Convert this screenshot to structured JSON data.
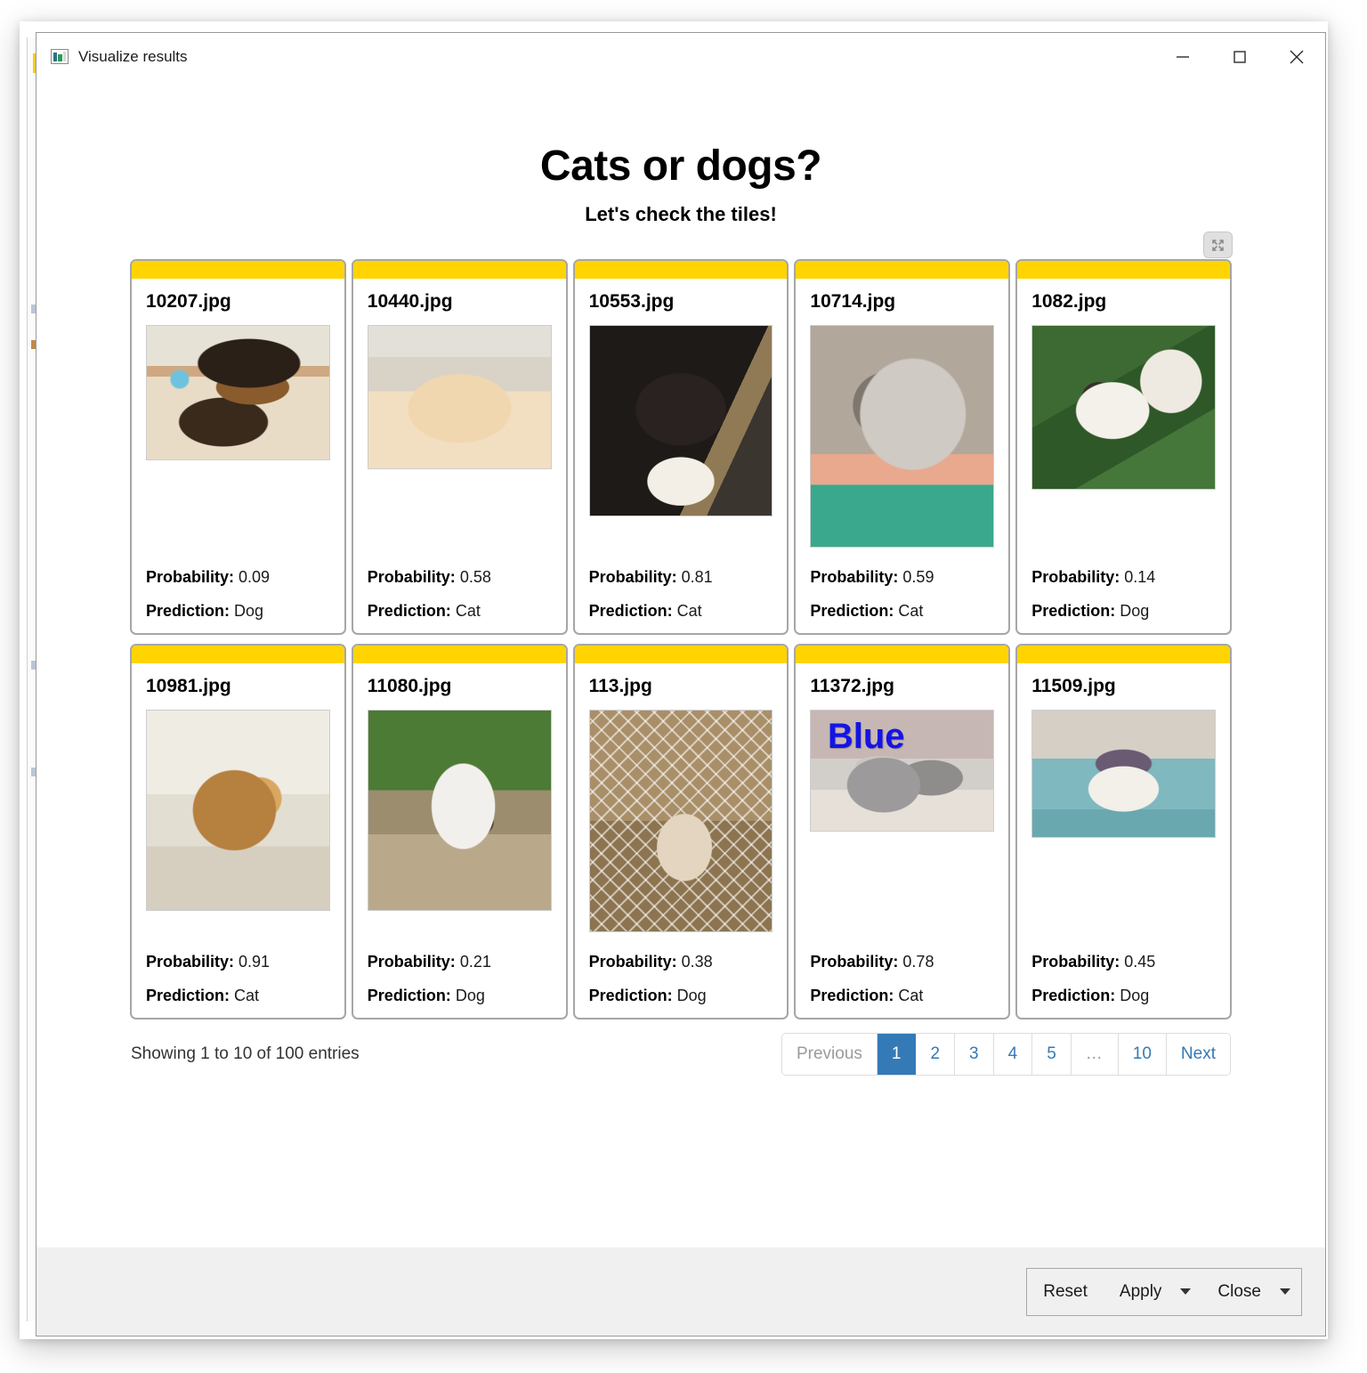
{
  "window": {
    "title": "Visualize results",
    "icon": "app-window-icon",
    "controls": {
      "minimize": "minimize-icon",
      "maximize": "maximize-icon",
      "close": "close-icon"
    }
  },
  "page": {
    "title": "Cats or dogs?",
    "subtitle": "Let's check the tiles!"
  },
  "widget": {
    "expand_button_icon": "expand-icon",
    "labels": {
      "probability": "Probability:",
      "prediction": "Prediction:"
    },
    "accent_color": "#ffd400",
    "active_page_color": "#337ab7",
    "cards": [
      {
        "filename": "10207.jpg",
        "probability": "0.09",
        "prediction": "Dog",
        "art": "ph-dog1",
        "overlay": "",
        "aspect": "0.78"
      },
      {
        "filename": "10440.jpg",
        "probability": "0.58",
        "prediction": "Cat",
        "art": "ph-cat1",
        "overlay": "",
        "aspect": "0.83"
      },
      {
        "filename": "10553.jpg",
        "probability": "0.81",
        "prediction": "Cat",
        "art": "ph-cat2",
        "overlay": "",
        "aspect": "1.10"
      },
      {
        "filename": "10714.jpg",
        "probability": "0.59",
        "prediction": "Cat",
        "art": "ph-dog2",
        "overlay": "",
        "aspect": "1.28"
      },
      {
        "filename": "1082.jpg",
        "probability": "0.14",
        "prediction": "Dog",
        "art": "ph-dog3",
        "overlay": "",
        "aspect": "0.95"
      },
      {
        "filename": "10981.jpg",
        "probability": "0.91",
        "prediction": "Cat",
        "art": "ph-dog4",
        "overlay": "",
        "aspect": "1.16"
      },
      {
        "filename": "11080.jpg",
        "probability": "0.21",
        "prediction": "Dog",
        "art": "ph-dog5",
        "overlay": "",
        "aspect": "1.16"
      },
      {
        "filename": "113.jpg",
        "probability": "0.38",
        "prediction": "Dog",
        "art": "ph-dog6",
        "overlay": "",
        "aspect": "1.28"
      },
      {
        "filename": "11372.jpg",
        "probability": "0.78",
        "prediction": "Cat",
        "art": "ph-cat3",
        "overlay": "Blue",
        "aspect": "0.70"
      },
      {
        "filename": "11509.jpg",
        "probability": "0.45",
        "prediction": "Dog",
        "art": "ph-cat4",
        "overlay": "",
        "aspect": "0.74"
      }
    ],
    "entries_info": "Showing 1 to 10 of 100 entries",
    "pagination": [
      {
        "label": "Previous",
        "state": "disabled"
      },
      {
        "label": "1",
        "state": "active"
      },
      {
        "label": "2",
        "state": "normal"
      },
      {
        "label": "3",
        "state": "normal"
      },
      {
        "label": "4",
        "state": "normal"
      },
      {
        "label": "5",
        "state": "normal"
      },
      {
        "label": "…",
        "state": "ellipsis"
      },
      {
        "label": "10",
        "state": "normal"
      },
      {
        "label": "Next",
        "state": "normal"
      }
    ]
  },
  "footer": {
    "reset_label": "Reset",
    "apply_label": "Apply",
    "close_label": "Close"
  }
}
